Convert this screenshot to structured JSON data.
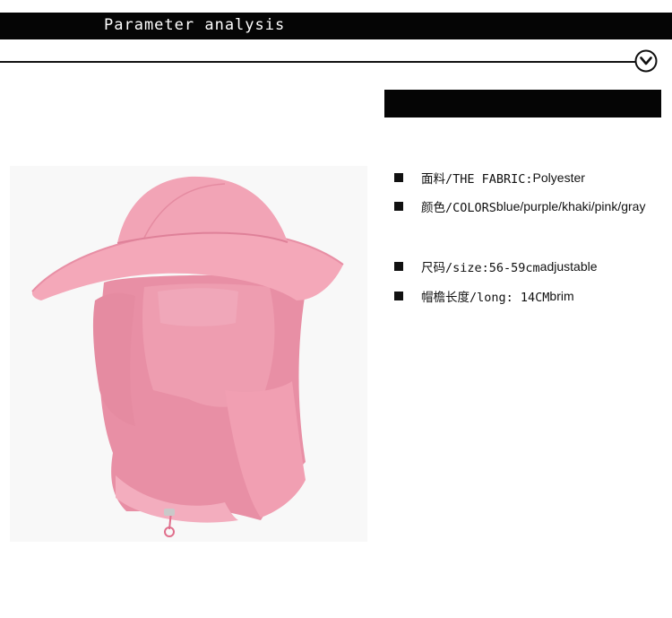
{
  "header": {
    "title": "Parameter analysis"
  },
  "specs": [
    {
      "label": "面料/THE  FABRIC: ",
      "value": "Polyester"
    },
    {
      "label": "颜色/COLORS ",
      "value": "blue/purple/khaki/pink/gray"
    },
    {
      "label": "尺码/size:56-59cm  ",
      "value": "adjustable"
    },
    {
      "label": "帽檐长度/long: 14CM  ",
      "value": "brim"
    }
  ],
  "colors": {
    "bar": "#050505",
    "hat_pink": "#f0a2b4",
    "background": "#ffffff"
  },
  "icons": {
    "header_icon": "chevron-down-circle-icon",
    "bullet_icon": "square-bullet-icon"
  }
}
